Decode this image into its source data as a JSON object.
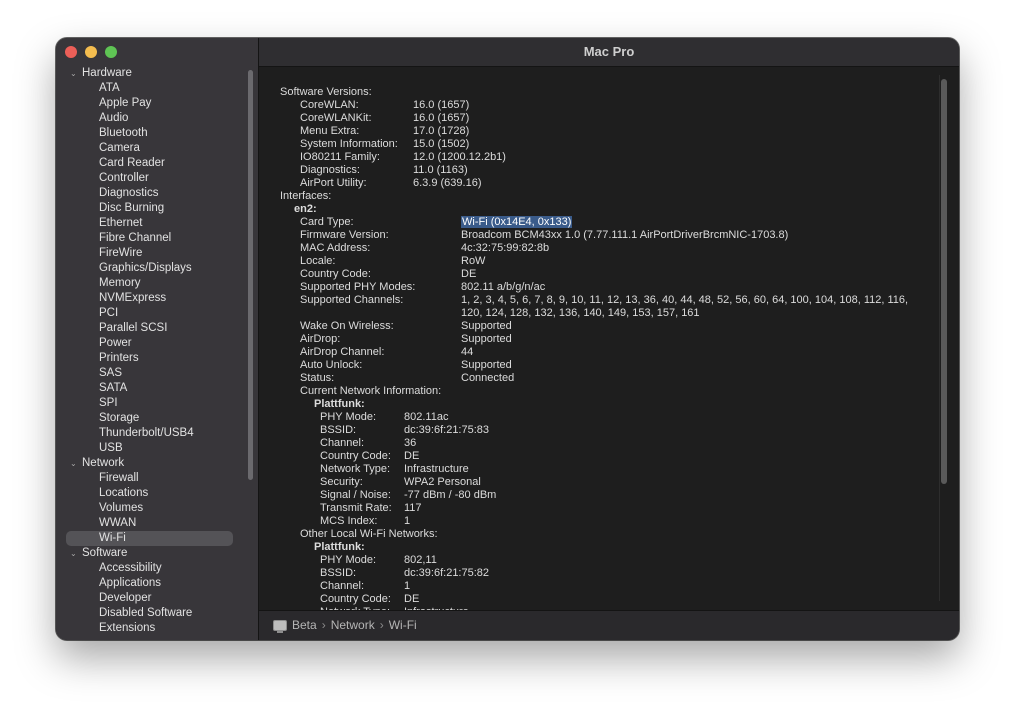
{
  "window": {
    "title": "Mac Pro"
  },
  "sidebar": {
    "groups": [
      {
        "label": "Hardware",
        "items": [
          "ATA",
          "Apple Pay",
          "Audio",
          "Bluetooth",
          "Camera",
          "Card Reader",
          "Controller",
          "Diagnostics",
          "Disc Burning",
          "Ethernet",
          "Fibre Channel",
          "FireWire",
          "Graphics/Displays",
          "Memory",
          "NVMExpress",
          "PCI",
          "Parallel SCSI",
          "Power",
          "Printers",
          "SAS",
          "SATA",
          "SPI",
          "Storage",
          "Thunderbolt/USB4",
          "USB"
        ]
      },
      {
        "label": "Network",
        "items": [
          "Firewall",
          "Locations",
          "Volumes",
          "WWAN",
          "Wi-Fi"
        ]
      },
      {
        "label": "Software",
        "items": [
          "Accessibility",
          "Applications",
          "Developer",
          "Disabled Software",
          "Extensions"
        ]
      }
    ],
    "selected": "Wi-Fi"
  },
  "details": [
    {
      "indent": 0,
      "label": "Software Versions:",
      "value": "",
      "bold": false
    },
    {
      "indent": 1,
      "label": "CoreWLAN:",
      "value": "16.0 (1657)"
    },
    {
      "indent": 1,
      "label": "CoreWLANKit:",
      "value": "16.0 (1657)"
    },
    {
      "indent": 1,
      "label": "Menu Extra:",
      "value": "17.0 (1728)"
    },
    {
      "indent": 1,
      "label": "System Information:",
      "value": "15.0 (1502)"
    },
    {
      "indent": 1,
      "label": "IO80211 Family:",
      "value": "12.0 (1200.12.2b1)"
    },
    {
      "indent": 1,
      "label": "Diagnostics:",
      "value": "11.0 (1163)"
    },
    {
      "indent": 1,
      "label": "AirPort Utility:",
      "value": "6.3.9 (639.16)"
    },
    {
      "indent": 0,
      "label": "Interfaces:",
      "value": ""
    },
    {
      "indent": 2,
      "label": "en2:",
      "value": "",
      "bold": true
    },
    {
      "indent": 3,
      "label": "Card Type:",
      "value": "Wi-Fi  (0x14E4, 0x133)",
      "highlight": true
    },
    {
      "indent": 3,
      "label": "Firmware Version:",
      "value": "Broadcom BCM43xx 1.0 (7.77.111.1 AirPortDriverBrcmNIC-1703.8)"
    },
    {
      "indent": 3,
      "label": "MAC Address:",
      "value": "4c:32:75:99:82:8b"
    },
    {
      "indent": 3,
      "label": "Locale:",
      "value": "RoW"
    },
    {
      "indent": 3,
      "label": "Country Code:",
      "value": "DE"
    },
    {
      "indent": 3,
      "label": "Supported PHY Modes:",
      "value": "802.11 a/b/g/n/ac"
    },
    {
      "indent": 3,
      "label": "Supported Channels:",
      "value": "1, 2, 3, 4, 5, 6, 7, 8, 9, 10, 11, 12, 13, 36, 40, 44, 48, 52, 56, 60, 64, 100, 104, 108, 112, 116,"
    },
    {
      "indent": 3,
      "label": "",
      "value": "120, 124, 128, 132, 136, 140, 149, 153, 157, 161"
    },
    {
      "indent": 3,
      "label": "Wake On Wireless:",
      "value": "Supported"
    },
    {
      "indent": 3,
      "label": "AirDrop:",
      "value": "Supported"
    },
    {
      "indent": 3,
      "label": "AirDrop Channel:",
      "value": "44"
    },
    {
      "indent": 3,
      "label": "Auto Unlock:",
      "value": "Supported"
    },
    {
      "indent": 3,
      "label": "Status:",
      "value": "Connected"
    },
    {
      "indent": 3,
      "label": "Current Network Information:",
      "value": ""
    },
    {
      "indent": 4,
      "label": "Plattfunk:",
      "value": "",
      "bold": true
    },
    {
      "indent": 5,
      "label": "PHY Mode:",
      "value": "802.11ac"
    },
    {
      "indent": 5,
      "label": "BSSID:",
      "value": "dc:39:6f:21:75:83"
    },
    {
      "indent": 5,
      "label": "Channel:",
      "value": "36"
    },
    {
      "indent": 5,
      "label": "Country Code:",
      "value": "DE"
    },
    {
      "indent": 5,
      "label": "Network Type:",
      "value": "Infrastructure"
    },
    {
      "indent": 5,
      "label": "Security:",
      "value": "WPA2 Personal"
    },
    {
      "indent": 5,
      "label": "Signal / Noise:",
      "value": "-77 dBm / -80 dBm"
    },
    {
      "indent": 5,
      "label": "Transmit Rate:",
      "value": "117"
    },
    {
      "indent": 5,
      "label": "MCS Index:",
      "value": "1"
    },
    {
      "indent": 3,
      "label": "Other Local Wi-Fi Networks:",
      "value": ""
    },
    {
      "indent": 4,
      "label": "Plattfunk:",
      "value": "",
      "bold": true
    },
    {
      "indent": 5,
      "label": "PHY Mode:",
      "value": "802,11"
    },
    {
      "indent": 5,
      "label": "BSSID:",
      "value": "dc:39:6f:21:75:82"
    },
    {
      "indent": 5,
      "label": "Channel:",
      "value": "1"
    },
    {
      "indent": 5,
      "label": "Country Code:",
      "value": "DE"
    },
    {
      "indent": 5,
      "label": "Network Type:",
      "value": "Infrastructure"
    }
  ],
  "breadcrumb": {
    "items": [
      "Beta",
      "Network",
      "Wi-Fi"
    ],
    "separator": "›"
  }
}
